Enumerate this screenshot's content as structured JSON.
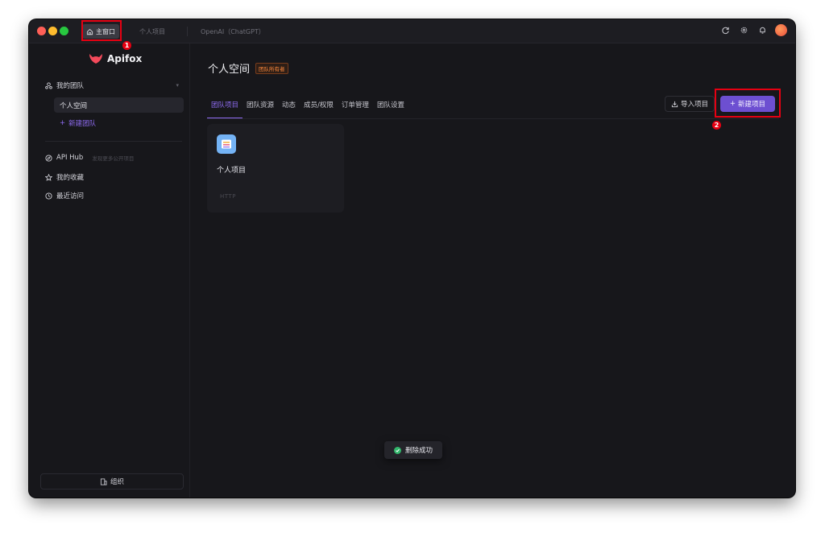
{
  "titlebar": {
    "tabs": [
      {
        "label": "主窗口",
        "icon": "home-icon"
      },
      {
        "label": "个人项目"
      },
      {
        "label": "OpenAI（ChatGPT）"
      }
    ],
    "icons": [
      "refresh-icon",
      "gear-icon",
      "bell-icon",
      "avatar"
    ]
  },
  "annotations": {
    "badge_1": "1",
    "badge_2": "2"
  },
  "sidebar": {
    "logo": "Apifox",
    "team_label": "我的团队",
    "space_item": "个人空间",
    "new_team": "新建团队",
    "api_hub": "API Hub",
    "api_hub_sub": "发现更多公开项目",
    "favorites": "我的收藏",
    "recent": "最近访问",
    "org_button": "组织"
  },
  "main": {
    "title": "个人空间",
    "owner_badge": "团队所有者",
    "tabs": [
      {
        "label": "团队项目",
        "active": true
      },
      {
        "label": "团队资源"
      },
      {
        "label": "动态"
      },
      {
        "label": "成员/权限"
      },
      {
        "label": "订单管理"
      },
      {
        "label": "团队设置"
      }
    ],
    "import_button": "导入项目",
    "new_project_button": "新建项目",
    "project_card": {
      "name": "个人项目",
      "type": "HTTP"
    },
    "toast": "删除成功"
  },
  "colors": {
    "accent": "#6d4fd1",
    "annotation": "#e60012",
    "success": "#32b66b",
    "badge": "#ff8a3d"
  }
}
